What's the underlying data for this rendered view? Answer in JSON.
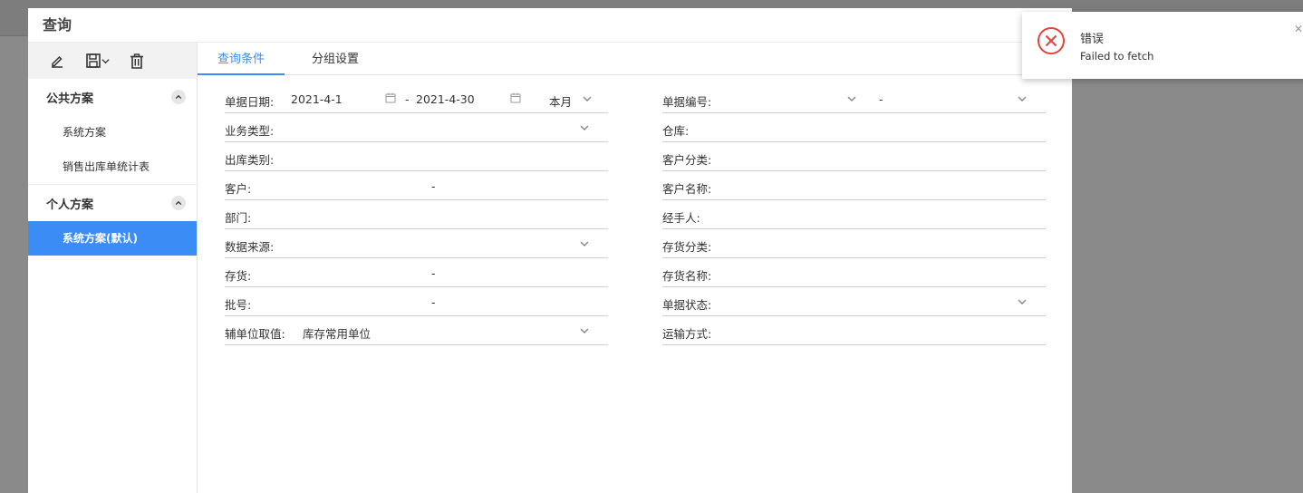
{
  "dialog": {
    "title": "查询"
  },
  "toolbar": {
    "edit_icon": "pencil-icon",
    "save_icon": "floppy-disk-icon",
    "delete_icon": "trash-icon"
  },
  "sidebar": {
    "groups": [
      {
        "label": "公共方案",
        "items": [
          "系统方案",
          "销售出库单统计表"
        ]
      },
      {
        "label": "个人方案",
        "items": [
          "系统方案(默认)"
        ]
      }
    ],
    "active_item": "系统方案(默认)",
    "active_color": "#3b8cf5"
  },
  "tabs": [
    {
      "label": "查询条件",
      "active": true
    },
    {
      "label": "分组设置",
      "active": false
    }
  ],
  "form": {
    "left": [
      {
        "label": "单据日期:",
        "start": "2021-4-1",
        "sep": "-",
        "end": "2021-4-30",
        "period": "本月"
      },
      {
        "label": "业务类型:"
      },
      {
        "label": "出库类别:"
      },
      {
        "label": "客户:",
        "sep": "-"
      },
      {
        "label": "部门:"
      },
      {
        "label": "数据来源:"
      },
      {
        "label": "存货:",
        "sep": "-"
      },
      {
        "label": "批号:",
        "sep": "-"
      },
      {
        "label": "辅单位取值:",
        "value": "库存常用单位"
      }
    ],
    "right": [
      {
        "label": "单据编号:",
        "sep": "-"
      },
      {
        "label": "仓库:"
      },
      {
        "label": "客户分类:"
      },
      {
        "label": "客户名称:"
      },
      {
        "label": "经手人:"
      },
      {
        "label": "存货分类:"
      },
      {
        "label": "存货名称:"
      },
      {
        "label": "单据状态:"
      },
      {
        "label": "运输方式:"
      }
    ]
  },
  "toast": {
    "title": "错误",
    "message": "Failed to fetch",
    "icon": "error-circle-icon",
    "icon_color": "#e0443a"
  }
}
